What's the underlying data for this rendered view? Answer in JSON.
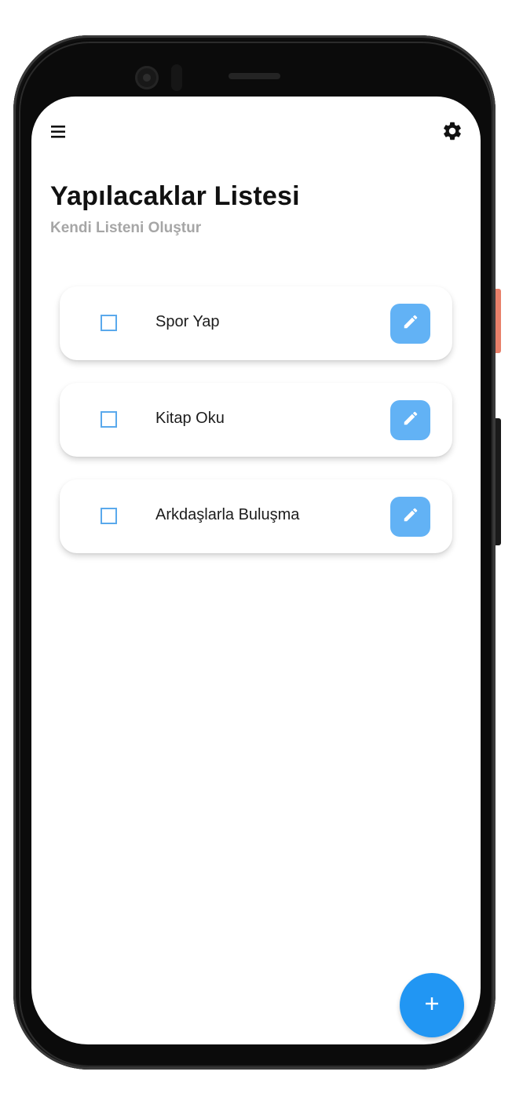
{
  "header": {
    "menu_icon": "menu-icon",
    "settings_icon": "settings-gear-icon",
    "title": "Yapılacaklar Listesi",
    "subtitle": "Kendi Listeni Oluştur"
  },
  "todos": [
    {
      "label": "Spor Yap",
      "checked": false,
      "edit_icon": "pencil-icon"
    },
    {
      "label": "Kitap Oku",
      "checked": false,
      "edit_icon": "pencil-icon"
    },
    {
      "label": "Arkdaşlarla Buluşma",
      "checked": false,
      "edit_icon": "pencil-icon"
    }
  ],
  "fab": {
    "icon": "plus-icon"
  },
  "colors": {
    "checkbox_border": "#5aa9ec",
    "edit_button": "#62b2f5",
    "fab": "#2196f3",
    "subtitle": "#a6a6a6",
    "device_accent": "#e8806a"
  }
}
